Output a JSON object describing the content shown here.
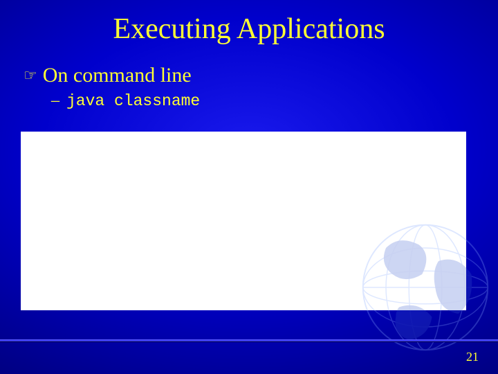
{
  "title": "Executing Applications",
  "bullet": {
    "text": "On command line"
  },
  "subbullet": {
    "dash": "–",
    "code": "java classname"
  },
  "page_number": "21"
}
